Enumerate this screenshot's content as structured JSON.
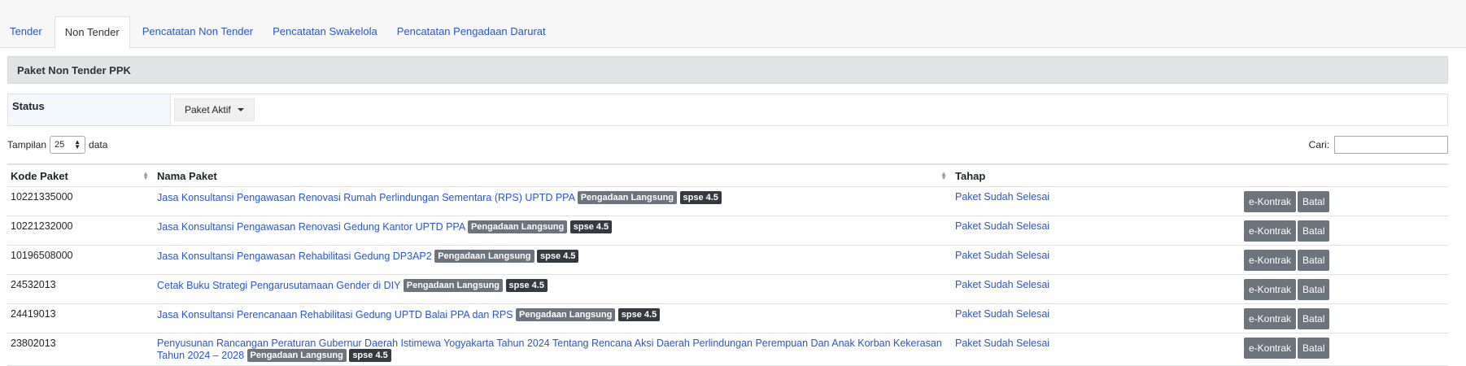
{
  "tabs": [
    {
      "label": "Tender"
    },
    {
      "label": "Non Tender"
    },
    {
      "label": "Pencatatan Non Tender"
    },
    {
      "label": "Pencatatan Swakelola"
    },
    {
      "label": "Pencatatan Pengadaan Darurat"
    }
  ],
  "panel": {
    "title": "Paket Non Tender PPK"
  },
  "status": {
    "label": "Status",
    "selected": "Paket Aktif"
  },
  "length": {
    "prefix": "Tampilan",
    "value": "25",
    "suffix": "data"
  },
  "search": {
    "label": "Cari:",
    "value": ""
  },
  "table": {
    "headers": {
      "kode": "Kode Paket",
      "nama": "Nama Paket",
      "tahap": "Tahap"
    },
    "rows": [
      {
        "kode": "10221335000",
        "nama": "Jasa Konsultansi Pengawasan Renovasi Rumah Perlindungan Sementara (RPS) UPTD PPA",
        "badge1": "Pengadaan Langsung",
        "badge2": "spse 4.5",
        "tahap": "Paket Sudah Selesai",
        "btn1": "e-Kontrak",
        "btn2": "Batal"
      },
      {
        "kode": "10221232000",
        "nama": "Jasa Konsultansi Pengawasan Renovasi Gedung Kantor UPTD PPA",
        "badge1": "Pengadaan Langsung",
        "badge2": "spse 4.5",
        "tahap": "Paket Sudah Selesai",
        "btn1": "e-Kontrak",
        "btn2": "Batal"
      },
      {
        "kode": "10196508000",
        "nama": "Jasa Konsultansi Pengawasan Rehabilitasi Gedung DP3AP2",
        "badge1": "Pengadaan Langsung",
        "badge2": "spse 4.5",
        "tahap": "Paket Sudah Selesai",
        "btn1": "e-Kontrak",
        "btn2": "Batal"
      },
      {
        "kode": "24532013",
        "nama": "Cetak Buku Strategi Pengarusutamaan Gender di DIY",
        "badge1": "Pengadaan Langsung",
        "badge2": "spse 4.5",
        "tahap": "Paket Sudah Selesai",
        "btn1": "e-Kontrak",
        "btn2": "Batal"
      },
      {
        "kode": "24419013",
        "nama": "Jasa Konsultansi Perencanaan Rehabilitasi Gedung UPTD Balai PPA dan RPS",
        "badge1": "Pengadaan Langsung",
        "badge2": "spse 4.5",
        "tahap": "Paket Sudah Selesai",
        "btn1": "e-Kontrak",
        "btn2": "Batal"
      },
      {
        "kode": "23802013",
        "nama": "Penyusunan Rancangan Peraturan Gubernur Daerah Istimewa Yogyakarta Tahun 2024 Tentang Rencana Aksi Daerah Perlindungan Perempuan Dan Anak Korban Kekerasan Tahun 2024 – 2028",
        "badge1": "Pengadaan Langsung",
        "badge2": "spse 4.5",
        "tahap": "Paket Sudah Selesai",
        "btn1": "e-Kontrak",
        "btn2": "Batal"
      }
    ]
  }
}
